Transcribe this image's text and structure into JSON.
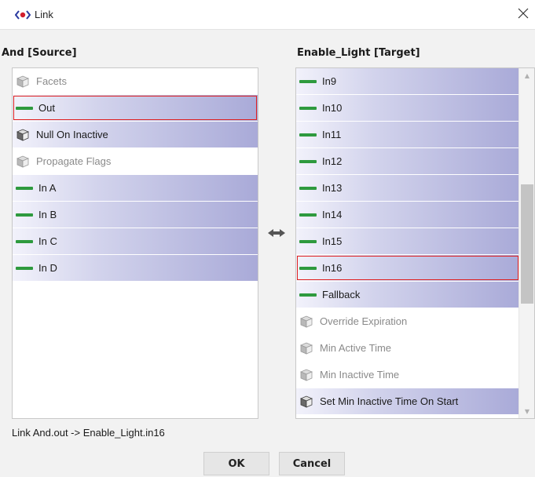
{
  "window": {
    "title": "Link",
    "close_glyph": "✕"
  },
  "source": {
    "header": "And [Source]",
    "rows": [
      {
        "label": "Facets",
        "kind": "prop",
        "icon": "box-icon"
      },
      {
        "label": "Out",
        "kind": "slot",
        "icon": "slot-bar-icon",
        "selected": true
      },
      {
        "label": "Null On Inactive",
        "kind": "prop-dark",
        "icon": "box-icon"
      },
      {
        "label": "Propagate Flags",
        "kind": "prop",
        "icon": "box-icon"
      },
      {
        "label": "In A",
        "kind": "slot",
        "icon": "slot-bar-icon"
      },
      {
        "label": "In B",
        "kind": "slot",
        "icon": "slot-bar-icon"
      },
      {
        "label": "In C",
        "kind": "slot",
        "icon": "slot-bar-icon"
      },
      {
        "label": "In D",
        "kind": "slot",
        "icon": "slot-bar-icon"
      }
    ]
  },
  "target": {
    "header": "Enable_Light [Target]",
    "rows": [
      {
        "label": "In9",
        "kind": "slot",
        "icon": "slot-bar-icon"
      },
      {
        "label": "In10",
        "kind": "slot",
        "icon": "slot-bar-icon"
      },
      {
        "label": "In11",
        "kind": "slot",
        "icon": "slot-bar-icon"
      },
      {
        "label": "In12",
        "kind": "slot",
        "icon": "slot-bar-icon"
      },
      {
        "label": "In13",
        "kind": "slot",
        "icon": "slot-bar-icon"
      },
      {
        "label": "In14",
        "kind": "slot",
        "icon": "slot-bar-icon"
      },
      {
        "label": "In15",
        "kind": "slot",
        "icon": "slot-bar-icon"
      },
      {
        "label": "In16",
        "kind": "slot",
        "icon": "slot-bar-icon",
        "selected": true
      },
      {
        "label": "Fallback",
        "kind": "slot",
        "icon": "slot-bar-icon"
      },
      {
        "label": "Override Expiration",
        "kind": "prop",
        "icon": "box-icon"
      },
      {
        "label": "Min Active Time",
        "kind": "prop",
        "icon": "box-icon"
      },
      {
        "label": "Min Inactive Time",
        "kind": "prop",
        "icon": "box-icon"
      },
      {
        "label": "Set Min Inactive Time On Start",
        "kind": "prop-dark",
        "icon": "box-icon"
      }
    ],
    "scroll_up_glyph": "▲",
    "scroll_down_glyph": "▼"
  },
  "link_arrow_icon": "bidirectional-arrow-icon",
  "status": "Link And.out -> Enable_Light.in16",
  "buttons": {
    "ok": "OK",
    "cancel": "Cancel"
  },
  "colors": {
    "slot_bar": "#2e9a3e",
    "row_gradient_end": "#a9aad8",
    "selection_border": "#e02020",
    "title_icon": "#2a3aa0"
  }
}
